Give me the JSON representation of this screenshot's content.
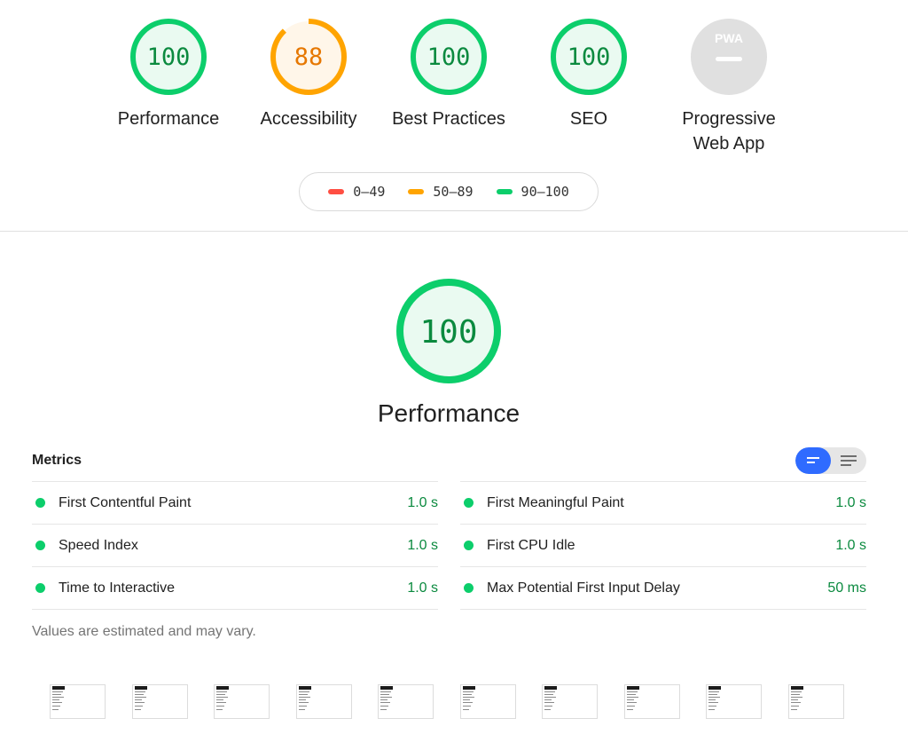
{
  "colors": {
    "pass": "#0cce6b",
    "pass_text": "#0b8a3f",
    "pass_fill": "#eafaf1",
    "average": "#ffa400",
    "average_text": "#e67700",
    "average_fill": "#fff6e9",
    "fail": "#ff4e42",
    "na": "#e0e0e0",
    "accent": "#2f6bff"
  },
  "categories": [
    {
      "label": "Performance",
      "score": "100",
      "rating": "pass"
    },
    {
      "label": "Accessibility",
      "score": "88",
      "rating": "average"
    },
    {
      "label": "Best Practices",
      "score": "100",
      "rating": "pass"
    },
    {
      "label": "SEO",
      "score": "100",
      "rating": "pass"
    },
    {
      "label_line1": "Progressive",
      "label_line2": "Web App",
      "badge": "PWA",
      "rating": "na",
      "icon": "pwa-dash-icon"
    }
  ],
  "legend": [
    {
      "range": "0–49",
      "rating": "fail"
    },
    {
      "range": "50–89",
      "rating": "average"
    },
    {
      "range": "90–100",
      "rating": "pass"
    }
  ],
  "main": {
    "score": "100",
    "title": "Performance"
  },
  "metrics": {
    "heading": "Metrics",
    "toggle_icons": [
      "compact-view-icon",
      "expanded-view-icon"
    ],
    "left": [
      {
        "name": "First Contentful Paint",
        "value": "1.0 s"
      },
      {
        "name": "Speed Index",
        "value": "1.0 s"
      },
      {
        "name": "Time to Interactive",
        "value": "1.0 s"
      }
    ],
    "right": [
      {
        "name": "First Meaningful Paint",
        "value": "1.0 s"
      },
      {
        "name": "First CPU Idle",
        "value": "1.0 s"
      },
      {
        "name": "Max Potential First Input Delay",
        "value": "50 ms"
      }
    ],
    "note": "Values are estimated and may vary."
  },
  "filmstrip": {
    "frame_count": 10
  }
}
